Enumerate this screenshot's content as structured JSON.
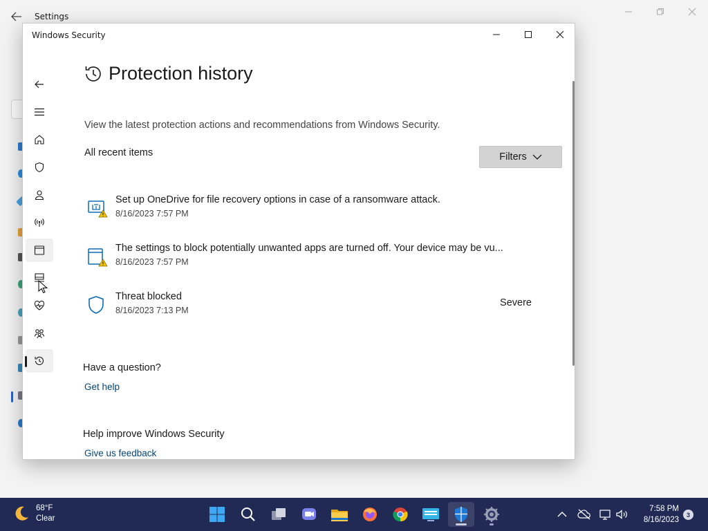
{
  "background_window": {
    "title": "Settings"
  },
  "window": {
    "title": "Windows Security"
  },
  "page": {
    "title": "Protection history",
    "description": "View the latest protection actions and recommendations from Windows Security.",
    "section_label": "All recent items",
    "filters_label": "Filters"
  },
  "history_items": [
    {
      "title": "Set up OneDrive for file recovery options in case of a ransomware attack.",
      "date": "8/16/2023 7:57 PM",
      "severity": "",
      "icon": "onedrive-warning-icon"
    },
    {
      "title": "The settings to block potentially unwanted apps are turned off. Your device may be vu...",
      "date": "8/16/2023 7:57 PM",
      "severity": "",
      "icon": "app-browser-warning-icon"
    },
    {
      "title": "Threat blocked",
      "date": "8/16/2023 7:13 PM",
      "severity": "Severe",
      "icon": "shield-icon"
    }
  ],
  "help": {
    "heading": "Have a question?",
    "link": "Get help"
  },
  "feedback": {
    "heading": "Help improve Windows Security",
    "link": "Give us feedback"
  },
  "nav_icons": [
    "back-arrow-icon",
    "hamburger-menu-icon",
    "home-icon",
    "shield-icon",
    "account-icon",
    "firewall-network-icon",
    "app-browser-icon",
    "device-security-icon",
    "device-health-icon",
    "family-options-icon",
    "protection-history-icon",
    "settings-gear-icon"
  ],
  "taskbar": {
    "weather_temp": "68°F",
    "weather_desc": "Clear",
    "time": "7:58 PM",
    "date": "8/16/2023",
    "notification_count": "3",
    "apps": [
      "start-icon",
      "search-icon",
      "task-view-icon",
      "teams-chat-icon",
      "file-explorer-icon",
      "firefox-icon",
      "chrome-icon",
      "remote-desktop-icon",
      "windows-security-icon",
      "settings-icon"
    ]
  },
  "colors": {
    "taskbar": "#202a55",
    "link": "#00457a",
    "accent_blue": "#0a6cb8",
    "warning": "#f5c400"
  }
}
